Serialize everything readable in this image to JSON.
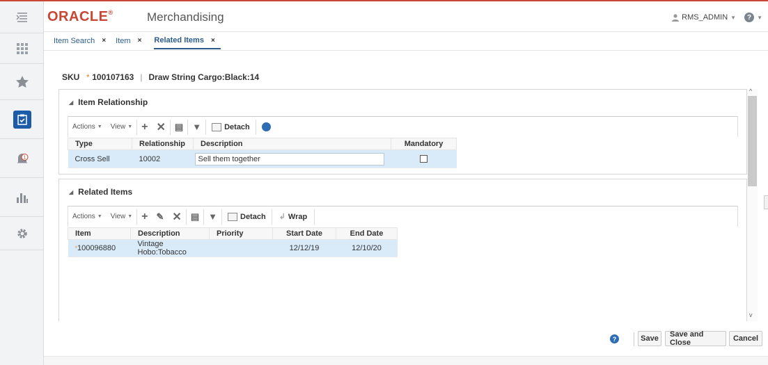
{
  "header": {
    "logo": "ORACLE",
    "app_name": "Merchandising",
    "user": "RMS_ADMIN",
    "help": "?"
  },
  "icons": {
    "nav": [
      "tasks-menu-icon",
      "apps-grid-icon",
      "favorites-star-icon",
      "task-clipboard-icon",
      "notifications-bell-icon",
      "reports-chart-icon",
      "settings-gear-icon"
    ],
    "notification_count": "1"
  },
  "tabs": [
    {
      "label": "Item Search",
      "close": "×"
    },
    {
      "label": "Item",
      "close": "×"
    },
    {
      "label": "Related Items",
      "close": "×"
    }
  ],
  "page": {
    "sku_label": "SKU",
    "sku_required": "*",
    "sku_value": "100107163",
    "separator": "|",
    "item_desc": "Draw String Cargo:Black:14"
  },
  "relationship_panel": {
    "title": "Item Relationship",
    "toolbar": {
      "actions": "Actions",
      "view": "View",
      "detach": "Detach"
    },
    "columns": [
      "Type",
      "Relationship",
      "Description",
      "Mandatory"
    ],
    "rows": [
      {
        "type": "Cross Sell",
        "relationship": "10002",
        "description": "Sell them together",
        "mandatory": false
      }
    ]
  },
  "related_panel": {
    "title": "Related Items",
    "toolbar": {
      "actions": "Actions",
      "view": "View",
      "detach": "Detach",
      "wrap": "Wrap"
    },
    "columns": [
      "Item",
      "Description",
      "Priority",
      "Start Date",
      "End Date"
    ],
    "rows": [
      {
        "required": "*",
        "item": "100096880",
        "description": "Vintage Hobo:Tobacco",
        "priority": "",
        "start_date": "12/12/19",
        "end_date": "12/10/20"
      }
    ]
  },
  "footer": {
    "help": "?",
    "save": "Save",
    "save_close": "Save and Close",
    "cancel": "Cancel"
  }
}
